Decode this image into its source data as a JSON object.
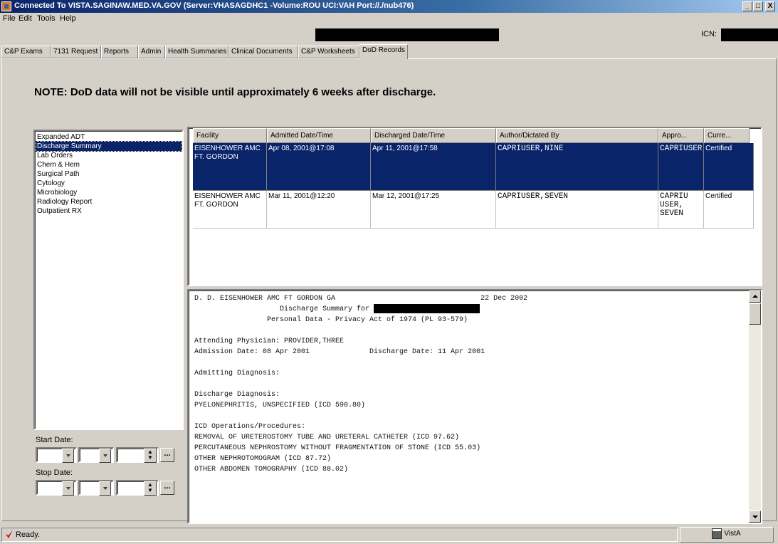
{
  "window": {
    "title": "Connected To VISTA.SAGINAW.MED.VA.GOV (Server:VHASAGDHC1 -Volume:ROU UCI:VAH Port://./nub476)",
    "btn_min": "_",
    "btn_max": "□",
    "btn_close": "X"
  },
  "menu": {
    "file": "File",
    "edit": "Edit",
    "tools": "Tools",
    "help": "Help"
  },
  "patient": {
    "icn_label": "ICN:"
  },
  "tabs": [
    {
      "label": "C&P Exams"
    },
    {
      "label": "7131 Request"
    },
    {
      "label": "Reports"
    },
    {
      "label": "Admin"
    },
    {
      "label": "Health Summaries"
    },
    {
      "label": "Clinical Documents"
    },
    {
      "label": "C&P Worksheets"
    },
    {
      "label": "DoD Records"
    }
  ],
  "note": "NOTE:  DoD data will not be visible until approximately 6 weeks after discharge.",
  "left_list": [
    "Expanded ADT",
    "Discharge Summary",
    "Lab Orders",
    "Chem & Hem",
    "Surgical Path",
    "Cytology",
    "Microbiology",
    "Radiology Report",
    "Outpatient RX"
  ],
  "dates": {
    "start_label": "Start Date:",
    "stop_label": "Stop Date:",
    "ellipsis": "...",
    "spin_up": "▲",
    "spin_down": "▼"
  },
  "grid": {
    "headers": [
      "Facility",
      "Admitted Date/Time",
      "Discharged Date/Time",
      "Author/Dictated By",
      "Appro...",
      "Curre..."
    ],
    "rows": [
      [
        "EISENHOWER AMC FT. GORDON",
        "Apr 08, 2001@17:08",
        "Apr 11, 2001@17:58",
        "CAPRIUSER,NINE",
        "CAPRIUSER,NINE",
        "Certified"
      ],
      [
        "EISENHOWER AMC FT. GORDON",
        "Mar 11, 2001@12:20",
        "Mar 12, 2001@17:25",
        "CAPRIUSER,SEVEN",
        "CAPRIU USER, SEVEN",
        "Certified"
      ]
    ]
  },
  "report": {
    "lines": [
      "D. D. EISENHOWER AMC FT GORDON GA                                  22 Dec 2002",
      "                    Discharge Summary for ",
      "                 Personal Data - Privacy Act of 1974 (PL 93-579)",
      "",
      "Attending Physician: PROVIDER,THREE",
      "Admission Date: 08 Apr 2001              Discharge Date: 11 Apr 2001",
      "",
      "Admitting Diagnosis:",
      "",
      "Discharge Diagnosis:",
      "PYELONEPHRITIS, UNSPECIFIED (ICD 590.80)",
      "",
      "ICD Operations/Procedures:",
      "REMOVAL OF URETEROSTOMY TUBE AND URETERAL CATHETER (ICD 97.62)",
      "PERCUTANEOUS NEPHROSTOMY WITHOUT FRAGMENTATION OF STONE (ICD 55.03)",
      "OTHER NEPHROTOMOGRAM (ICD 87.72)",
      "OTHER ABDOMEN TOMOGRAPHY (ICD 88.02)"
    ]
  },
  "status": {
    "text": "Ready.",
    "vista_button": "VistA"
  },
  "colors": {
    "selection": "#0a246a",
    "face": "#d4d0c8",
    "title_start": "#0a246a"
  }
}
